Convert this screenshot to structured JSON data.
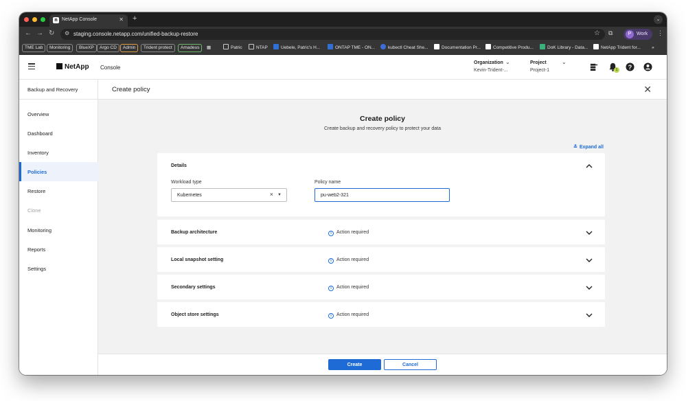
{
  "browser": {
    "tab_title": "NetApp Console",
    "tab_favicon": "n",
    "url": "staging.console.netapp.com/unified-backup-restore",
    "profile_label": "Work",
    "profile_initial": "P",
    "bookmarks": [
      "TME Lab",
      "Monitoring",
      "BlueXP",
      "Argo CD",
      "Admin",
      "Trident protect",
      "Amadeus",
      "Patric",
      "NTAP",
      "Uebele, Patric's H...",
      "ONTAP TME - ON...",
      "kubectl Cheat She...",
      "Documentation Pr...",
      "Competitive Produ...",
      "DoK Library - Data...",
      "NetApp Trident for..."
    ]
  },
  "header": {
    "logo": "NetApp",
    "app_name": "Console",
    "organization_label": "Organization",
    "organization_value": "Kevin-Trident-...",
    "project_label": "Project",
    "project_value": "Project-1",
    "notification_count": "1"
  },
  "sidebar": {
    "title": "Backup and Recovery",
    "items": [
      {
        "label": "Overview",
        "state": "normal"
      },
      {
        "label": "Dashboard",
        "state": "normal"
      },
      {
        "label": "Inventory",
        "state": "normal"
      },
      {
        "label": "Policies",
        "state": "active"
      },
      {
        "label": "Restore",
        "state": "normal"
      },
      {
        "label": "Clone",
        "state": "disabled"
      },
      {
        "label": "Monitoring",
        "state": "normal"
      },
      {
        "label": "Reports",
        "state": "normal"
      },
      {
        "label": "Settings",
        "state": "normal"
      }
    ]
  },
  "main": {
    "page_title": "Create policy",
    "form_title": "Create policy",
    "form_subtitle": "Create backup and recovery policy to protect your data",
    "expand_all": "Expand all",
    "details": {
      "title": "Details",
      "workload_type_label": "Workload type",
      "workload_type_value": "Kubernetes",
      "policy_name_label": "Policy name",
      "policy_name_value": "pu-web2-321"
    },
    "sections": [
      {
        "title": "Backup architecture",
        "status": "Action required"
      },
      {
        "title": "Local snapshot setting",
        "status": "Action required"
      },
      {
        "title": "Secondary settings",
        "status": "Action required"
      },
      {
        "title": "Object store settings",
        "status": "Action required"
      }
    ]
  },
  "footer": {
    "create_label": "Create",
    "cancel_label": "Cancel"
  },
  "colors": {
    "accent": "#1e6bd6",
    "background": "#f2f2f2"
  }
}
